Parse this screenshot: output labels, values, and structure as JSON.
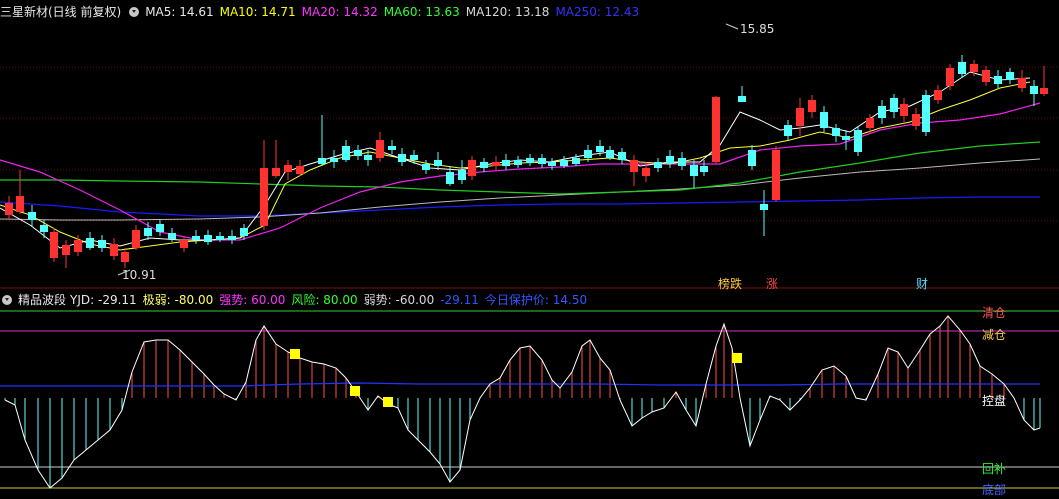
{
  "main": {
    "title": "三星新材(日线 前复权)",
    "ma5": "MA5: 14.61",
    "ma10": "MA10: 14.71",
    "ma20": "MA20: 14.32",
    "ma60": "MA60: 13.63",
    "ma120": "MA120: 13.18",
    "ma250": "MA250: 12.43",
    "high_label": "15.85",
    "low_label": "10.91",
    "badge_1": "榜跌",
    "badge_2": "涨",
    "badge_3": "财",
    "colors": {
      "ma5": "#ffffff",
      "ma10": "#ffff00",
      "ma20": "#ff00ff",
      "ma60": "#00ff00",
      "ma120": "#c0c0c0",
      "ma250": "#0000ff",
      "up": "#ff3232",
      "down": "#54ffff"
    }
  },
  "indicator": {
    "title": "精品波段",
    "yjd": "YJD: -29.11",
    "jiruo": "极弱: -80.00",
    "qiangshi": "强势: 60.00",
    "fengxian": "风险: 80.00",
    "ruoshi": "弱势: -60.00",
    "val": "-29.11",
    "protect": "今日保护价: 14.50",
    "label_qingcang": "清仓",
    "label_jiancang": "减仓",
    "label_kongpan": "控盘",
    "label_buji": "回补",
    "label_dibu": "底部"
  },
  "chart_data": {
    "type": "candlestick",
    "title": "三星新材(日线 前复权)",
    "high": 15.85,
    "low": 10.91,
    "ma_values": {
      "MA5": 14.61,
      "MA10": 14.71,
      "MA20": 14.32,
      "MA60": 13.63,
      "MA120": 13.18,
      "MA250": 12.43
    },
    "indicator_levels": {
      "风险": 80,
      "强势": 60,
      "弱势": -60,
      "极弱": -80
    },
    "indicator_current": -29.11,
    "protect_price": 14.5
  }
}
